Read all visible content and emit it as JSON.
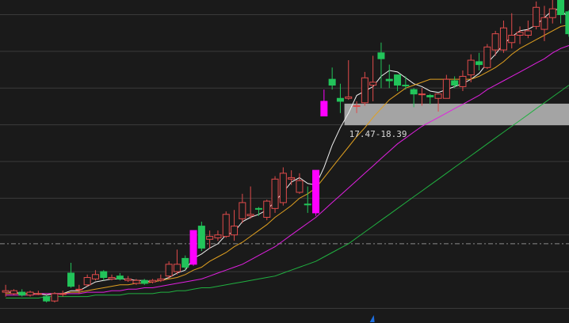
{
  "colors": {
    "background": "#1a1a1a",
    "grid": "#3a3a3a",
    "dash_line": "#8a8a8a",
    "up_candle": "#e04b4b",
    "down_candle": "#22c45a",
    "limit_up_candle": "#ff00ff",
    "ma5": "#f0f0f0",
    "ma10": "#e0a020",
    "ma20": "#e020e0",
    "ma60": "#20b040",
    "zone": "#b4b4b4",
    "marker": "#1e6fe0"
  },
  "chart_data": {
    "type": "candlestick",
    "ylim": [
      4,
      26
    ],
    "grid_levels": [
      5,
      7.5,
      10,
      12.5,
      15,
      17.5,
      20,
      22.5,
      25
    ],
    "reference_level": 9.4,
    "zone": {
      "low": 17.47,
      "high": 18.94,
      "start_index": 42,
      "label": "17.47-18.39"
    },
    "marker": {
      "index": 45,
      "icon": "triangle-up-icon"
    },
    "candles": [
      {
        "o": 6.2,
        "h": 6.6,
        "l": 5.8,
        "c": 6.1,
        "type": "up"
      },
      {
        "o": 6.0,
        "h": 6.3,
        "l": 5.9,
        "c": 6.2,
        "type": "up"
      },
      {
        "o": 6.1,
        "h": 6.3,
        "l": 5.8,
        "c": 5.9,
        "type": "down"
      },
      {
        "o": 5.9,
        "h": 6.2,
        "l": 5.8,
        "c": 6.1,
        "type": "up"
      },
      {
        "o": 6.0,
        "h": 6.2,
        "l": 5.9,
        "c": 6.0,
        "type": "up"
      },
      {
        "o": 5.8,
        "h": 5.9,
        "l": 5.4,
        "c": 5.5,
        "type": "down"
      },
      {
        "o": 5.5,
        "h": 6.1,
        "l": 5.4,
        "c": 6.0,
        "type": "up"
      },
      {
        "o": 6.0,
        "h": 6.2,
        "l": 5.8,
        "c": 6.0,
        "type": "up"
      },
      {
        "o": 6.5,
        "h": 8.1,
        "l": 6.4,
        "c": 7.4,
        "type": "down"
      },
      {
        "o": 6.3,
        "h": 6.6,
        "l": 6.0,
        "c": 6.3,
        "type": "up"
      },
      {
        "o": 6.6,
        "h": 7.3,
        "l": 6.5,
        "c": 7.1,
        "type": "up"
      },
      {
        "o": 7.0,
        "h": 7.6,
        "l": 6.9,
        "c": 7.3,
        "type": "up"
      },
      {
        "o": 7.5,
        "h": 7.6,
        "l": 6.9,
        "c": 7.1,
        "type": "down"
      },
      {
        "o": 7.0,
        "h": 7.3,
        "l": 6.9,
        "c": 7.1,
        "type": "up"
      },
      {
        "o": 7.2,
        "h": 7.4,
        "l": 6.9,
        "c": 7.0,
        "type": "down"
      },
      {
        "o": 7.0,
        "h": 7.2,
        "l": 6.8,
        "c": 6.9,
        "type": "up"
      },
      {
        "o": 6.9,
        "h": 7.0,
        "l": 6.6,
        "c": 6.7,
        "type": "up"
      },
      {
        "o": 6.9,
        "h": 7.0,
        "l": 6.6,
        "c": 6.7,
        "type": "down"
      },
      {
        "o": 6.8,
        "h": 7.0,
        "l": 6.7,
        "c": 6.9,
        "type": "up"
      },
      {
        "o": 6.9,
        "h": 7.3,
        "l": 6.8,
        "c": 7.0,
        "type": "up"
      },
      {
        "o": 7.2,
        "h": 8.2,
        "l": 7.0,
        "c": 8.0,
        "type": "up"
      },
      {
        "o": 7.5,
        "h": 9.0,
        "l": 7.3,
        "c": 8.0,
        "type": "up"
      },
      {
        "o": 8.4,
        "h": 8.6,
        "l": 7.6,
        "c": 7.8,
        "type": "down"
      },
      {
        "o": 8.0,
        "h": 10.3,
        "l": 7.9,
        "c": 10.3,
        "type": "limit"
      },
      {
        "o": 10.6,
        "h": 10.9,
        "l": 8.9,
        "c": 9.1,
        "type": "down"
      },
      {
        "o": 9.7,
        "h": 10.3,
        "l": 9.1,
        "c": 9.9,
        "type": "up"
      },
      {
        "o": 10.0,
        "h": 10.3,
        "l": 9.6,
        "c": 9.8,
        "type": "up"
      },
      {
        "o": 9.9,
        "h": 11.6,
        "l": 9.8,
        "c": 11.4,
        "type": "up"
      },
      {
        "o": 10.0,
        "h": 11.7,
        "l": 9.6,
        "c": 10.6,
        "type": "up"
      },
      {
        "o": 11.1,
        "h": 12.8,
        "l": 10.8,
        "c": 12.2,
        "type": "up"
      },
      {
        "o": 11.3,
        "h": 13.3,
        "l": 11.1,
        "c": 11.4,
        "type": "up"
      },
      {
        "o": 11.8,
        "h": 11.9,
        "l": 11.3,
        "c": 11.8,
        "type": "down"
      },
      {
        "o": 11.2,
        "h": 12.4,
        "l": 11.0,
        "c": 12.3,
        "type": "up"
      },
      {
        "o": 11.8,
        "h": 14.0,
        "l": 11.5,
        "c": 13.8,
        "type": "up"
      },
      {
        "o": 12.2,
        "h": 14.6,
        "l": 12.0,
        "c": 14.2,
        "type": "up"
      },
      {
        "o": 13.8,
        "h": 14.4,
        "l": 13.4,
        "c": 13.9,
        "type": "up"
      },
      {
        "o": 12.9,
        "h": 14.2,
        "l": 12.8,
        "c": 13.7,
        "type": "up"
      },
      {
        "o": 12.1,
        "h": 13.3,
        "l": 11.5,
        "c": 12.1,
        "type": "down"
      },
      {
        "o": 11.5,
        "h": 14.4,
        "l": 11.3,
        "c": 14.4,
        "type": "limit"
      },
      {
        "o": 19.1,
        "h": 19.9,
        "l": 18.3,
        "c": 18.1,
        "type": "limit"
      },
      {
        "o": 20.6,
        "h": 21.4,
        "l": 19.9,
        "c": 20.2,
        "type": "down"
      },
      {
        "o": 19.1,
        "h": 20.3,
        "l": 18.3,
        "c": 19.3,
        "type": "down"
      },
      {
        "o": 19.3,
        "h": 21.9,
        "l": 19.2,
        "c": 19.4,
        "type": "up"
      },
      {
        "o": 18.8,
        "h": 19.1,
        "l": 18.3,
        "c": 18.8,
        "type": "up"
      },
      {
        "o": 19.0,
        "h": 21.1,
        "l": 18.8,
        "c": 20.7,
        "type": "up"
      },
      {
        "o": 20.2,
        "h": 22.2,
        "l": 19.1,
        "c": 20.4,
        "type": "up"
      },
      {
        "o": 22.4,
        "h": 23.1,
        "l": 20.0,
        "c": 22.0,
        "type": "down"
      },
      {
        "o": 20.6,
        "h": 21.6,
        "l": 20.0,
        "c": 20.5,
        "type": "down"
      },
      {
        "o": 20.9,
        "h": 20.9,
        "l": 19.8,
        "c": 20.2,
        "type": "down"
      },
      {
        "o": 20.2,
        "h": 20.8,
        "l": 19.9,
        "c": 20.2,
        "type": "down"
      },
      {
        "o": 19.9,
        "h": 20.0,
        "l": 18.7,
        "c": 19.6,
        "type": "down"
      },
      {
        "o": 19.6,
        "h": 20.0,
        "l": 18.8,
        "c": 19.6,
        "type": "up"
      },
      {
        "o": 19.5,
        "h": 19.6,
        "l": 18.9,
        "c": 19.4,
        "type": "down"
      },
      {
        "o": 19.3,
        "h": 19.6,
        "l": 18.4,
        "c": 19.6,
        "type": "up"
      },
      {
        "o": 19.3,
        "h": 20.9,
        "l": 19.3,
        "c": 20.6,
        "type": "up"
      },
      {
        "o": 20.2,
        "h": 20.8,
        "l": 20.0,
        "c": 20.5,
        "type": "down"
      },
      {
        "o": 20.1,
        "h": 21.2,
        "l": 19.8,
        "c": 20.8,
        "type": "up"
      },
      {
        "o": 20.9,
        "h": 22.3,
        "l": 20.4,
        "c": 21.9,
        "type": "up"
      },
      {
        "o": 21.8,
        "h": 22.4,
        "l": 21.2,
        "c": 21.6,
        "type": "down"
      },
      {
        "o": 21.4,
        "h": 23.0,
        "l": 21.3,
        "c": 22.8,
        "type": "up"
      },
      {
        "o": 22.6,
        "h": 23.9,
        "l": 22.2,
        "c": 23.7,
        "type": "up"
      },
      {
        "o": 22.6,
        "h": 24.6,
        "l": 22.4,
        "c": 24.1,
        "type": "up"
      },
      {
        "o": 23.1,
        "h": 25.1,
        "l": 22.7,
        "c": 23.6,
        "type": "up"
      },
      {
        "o": 23.6,
        "h": 24.2,
        "l": 23.0,
        "c": 23.8,
        "type": "up"
      },
      {
        "o": 23.6,
        "h": 24.6,
        "l": 23.4,
        "c": 23.9,
        "type": "up"
      },
      {
        "o": 24.2,
        "h": 25.9,
        "l": 24.0,
        "c": 25.5,
        "type": "up"
      },
      {
        "o": 24.0,
        "h": 25.6,
        "l": 23.2,
        "c": 24.8,
        "type": "up"
      },
      {
        "o": 24.8,
        "h": 26.0,
        "l": 24.4,
        "c": 25.4,
        "type": "up"
      },
      {
        "o": 26.0,
        "h": 26.2,
        "l": 24.4,
        "c": 25.0,
        "type": "down"
      },
      {
        "o": 25.2,
        "h": 25.3,
        "l": 23.5,
        "c": 23.7,
        "type": "down"
      }
    ],
    "series": [
      {
        "key": "ma5",
        "values": [
          6.1,
          6.1,
          6.0,
          6.0,
          6.0,
          5.9,
          6.0,
          6.0,
          6.2,
          6.2,
          6.5,
          6.8,
          6.9,
          7.0,
          7.0,
          7.0,
          6.9,
          6.9,
          6.8,
          6.9,
          7.1,
          7.4,
          7.6,
          8.4,
          8.7,
          9.1,
          9.4,
          10.0,
          10.2,
          10.9,
          11.2,
          11.4,
          11.7,
          12.3,
          12.9,
          13.6,
          13.9,
          13.5,
          13.4,
          14.6,
          16.1,
          17.3,
          18.3,
          19.5,
          19.8,
          20.1,
          20.8,
          21.2,
          21.1,
          20.7,
          20.3,
          20.1,
          19.8,
          19.7,
          19.9,
          20.1,
          20.3,
          20.6,
          21.0,
          21.7,
          22.3,
          23.0,
          23.5,
          23.9,
          24.0,
          24.3,
          24.8,
          25.3,
          25.4,
          24.7
        ]
      },
      {
        "key": "ma10",
        "values": [
          6.0,
          6.0,
          6.0,
          6.0,
          6.0,
          6.0,
          6.0,
          6.0,
          6.1,
          6.1,
          6.2,
          6.3,
          6.4,
          6.5,
          6.6,
          6.6,
          6.7,
          6.7,
          6.8,
          6.9,
          7.0,
          7.1,
          7.3,
          7.6,
          7.8,
          8.2,
          8.5,
          8.8,
          9.2,
          9.5,
          9.9,
          10.3,
          10.7,
          11.2,
          11.6,
          12.0,
          12.5,
          12.8,
          13.2,
          13.9,
          14.6,
          15.3,
          16.0,
          16.7,
          17.3,
          18.0,
          18.6,
          19.2,
          19.6,
          20.0,
          20.2,
          20.4,
          20.6,
          20.6,
          20.6,
          20.6,
          20.6,
          20.6,
          20.8,
          21.1,
          21.4,
          21.8,
          22.3,
          22.7,
          23.0,
          23.3,
          23.6,
          23.9,
          24.2,
          24.3
        ]
      },
      {
        "key": "ma20",
        "values": [
          5.9,
          5.9,
          5.9,
          5.9,
          6.0,
          6.0,
          6.0,
          6.0,
          6.0,
          6.0,
          6.1,
          6.1,
          6.1,
          6.2,
          6.2,
          6.3,
          6.3,
          6.4,
          6.4,
          6.5,
          6.6,
          6.7,
          6.8,
          6.9,
          7.0,
          7.2,
          7.4,
          7.6,
          7.8,
          8.0,
          8.3,
          8.6,
          8.9,
          9.2,
          9.6,
          10.0,
          10.4,
          10.8,
          11.2,
          11.7,
          12.2,
          12.7,
          13.2,
          13.7,
          14.2,
          14.7,
          15.2,
          15.7,
          16.2,
          16.6,
          17.0,
          17.4,
          17.7,
          18.0,
          18.3,
          18.6,
          18.9,
          19.2,
          19.5,
          19.9,
          20.2,
          20.5,
          20.8,
          21.1,
          21.4,
          21.7,
          22.0,
          22.4,
          22.7,
          22.9
        ]
      },
      {
        "key": "ma60",
        "values": [
          5.7,
          5.7,
          5.7,
          5.7,
          5.7,
          5.8,
          5.8,
          5.8,
          5.8,
          5.8,
          5.8,
          5.9,
          5.9,
          5.9,
          5.9,
          6.0,
          6.0,
          6.0,
          6.0,
          6.1,
          6.1,
          6.2,
          6.2,
          6.3,
          6.4,
          6.4,
          6.5,
          6.6,
          6.7,
          6.8,
          6.9,
          7.0,
          7.1,
          7.2,
          7.4,
          7.6,
          7.8,
          8.0,
          8.2,
          8.5,
          8.8,
          9.1,
          9.4,
          9.8,
          10.2,
          10.6,
          11.0,
          11.4,
          11.8,
          12.2,
          12.6,
          13.0,
          13.4,
          13.8,
          14.2,
          14.6,
          15.0,
          15.4,
          15.8,
          16.2,
          16.6,
          17.0,
          17.4,
          17.8,
          18.2,
          18.6,
          19.0,
          19.4,
          19.8,
          20.2
        ]
      }
    ]
  }
}
